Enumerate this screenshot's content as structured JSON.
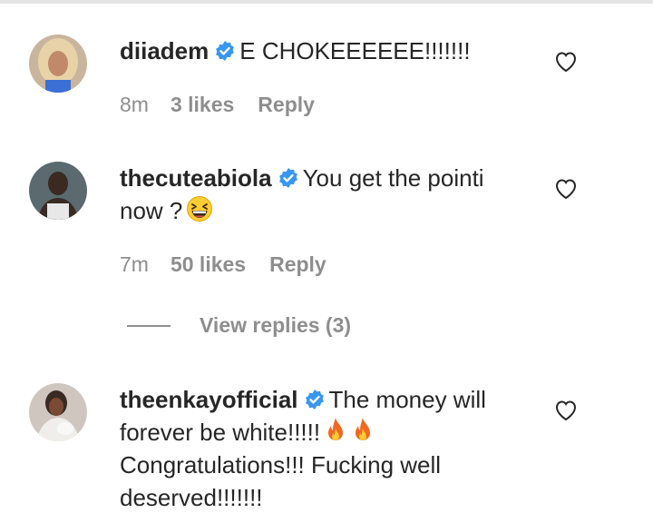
{
  "comments": [
    {
      "username": "diiadem",
      "text": "E CHOKEEEEEE!!!!!!!",
      "time": "8m",
      "likes": "3 likes",
      "reply_label": "Reply",
      "verified": true,
      "avatar_colors": {
        "bg": "#c9b49e",
        "hair": "#e8d2a8",
        "skin": "#c08a6a"
      }
    },
    {
      "username": "thecuteabiola",
      "text_line1": "You get the pointi",
      "text_line2": "now ?",
      "emoji": "grinning-squinting-face",
      "time": "7m",
      "likes": "50 likes",
      "reply_label": "Reply",
      "verified": true,
      "view_replies": "View replies (3)",
      "avatar_colors": {
        "bg": "#5a6a6e",
        "skin": "#3a2a22",
        "shirt": "#e8e8e8"
      }
    },
    {
      "username": "theenkayofficial",
      "text_line1": "The money will",
      "text_line2": "forever be white!!!!!",
      "text_line3": "Congratulations!!! Fucking well",
      "text_line4": "deserved!!!!!!!",
      "emoji": "fire",
      "verified": true,
      "avatar_colors": {
        "bg": "#cfc6c0",
        "skin": "#7a4a35",
        "outfit": "#f0eeea"
      }
    }
  ],
  "colors": {
    "text": "#262626",
    "muted": "#8e8e8e",
    "verified_blue": "#3897f0",
    "divider": "#e4e4e4"
  }
}
